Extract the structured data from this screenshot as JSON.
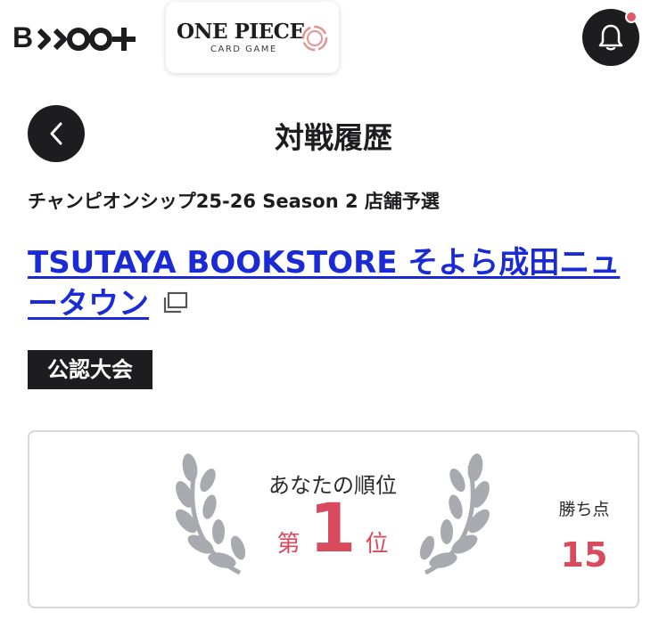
{
  "header": {
    "brand_logo_text": "B-TCG+",
    "game_logo_title": "ONE PIECE",
    "game_logo_subtitle": "CARD GAME",
    "bell_icon": "bell-icon"
  },
  "page": {
    "title": "対戦履歴",
    "back_icon": "chevron-left-icon"
  },
  "event": {
    "name": "チャンピオンシップ25-26 Season 2 店舗予選",
    "store_name": "TSUTAYA BOOKSTORE そよら成田ニュータウン",
    "tag": "公認大会"
  },
  "result": {
    "rank_label": "あなたの順位",
    "rank_prefix": "第",
    "rank_value": "1",
    "rank_suffix": "位",
    "points_label": "勝ち点",
    "points_value": "15"
  },
  "colors": {
    "accent": "#d94a5e",
    "link": "#1a2bd6",
    "dark": "#1d1d1f",
    "laurel": "#a9a9b0"
  }
}
